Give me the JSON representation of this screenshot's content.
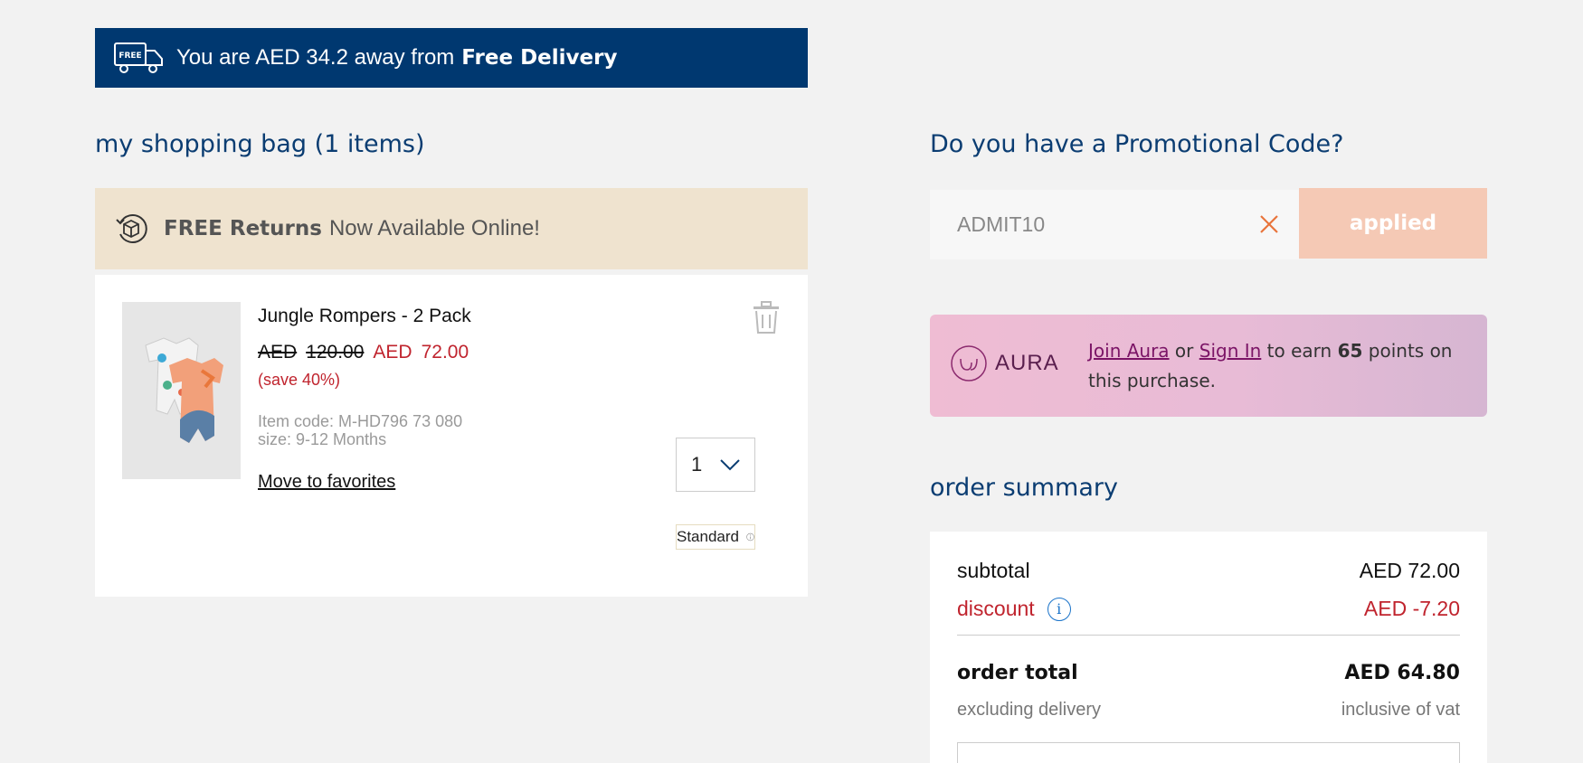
{
  "delivery_banner": {
    "icon": "free-delivery-truck-icon",
    "truck_label": "FREE",
    "message": "You are AED 34.2 away from",
    "highlight": "Free Delivery"
  },
  "bag": {
    "title": "my shopping bag (1 items)"
  },
  "returns_banner": {
    "icon": "returns-box-icon",
    "highlight": "FREE Returns",
    "message": "Now Available Online!"
  },
  "product": {
    "name": "Jungle Rompers - 2 Pack",
    "old_currency": "AED",
    "old_price": "120.00",
    "new_currency": "AED",
    "new_price": "72.00",
    "save": "(save 40%)",
    "item_code": "Item code: M-HD796 73 080",
    "size": "size: 9-12 Months",
    "favorites_link": "Move to favorites",
    "quantity": "1",
    "delivery_type": "Standard"
  },
  "promo": {
    "title": "Do you have a Promotional Code?",
    "code_value": "ADMIT10",
    "button_label": "applied"
  },
  "aura": {
    "logo_text": "AURA",
    "join_link": "Join Aura",
    "or_text": "or",
    "signin_link": "Sign In",
    "earn_text": "to earn",
    "points": "65",
    "points_suffix": "points on this purchase."
  },
  "summary": {
    "title": "order summary",
    "subtotal_label": "subtotal",
    "subtotal_value": "AED 72.00",
    "discount_label": "discount",
    "discount_value": "AED -7.20",
    "total_label": "order total",
    "total_value": "AED 64.80",
    "note_left": "excluding delivery",
    "note_right": "inclusive of vat"
  },
  "colors": {
    "brand_navy": "#003870",
    "title_blue": "#0b3d72",
    "sale_red": "#c0242e",
    "returns_beige": "#efe3cf",
    "applied_peach": "#f5c9b5",
    "aura_pink": "#efbcd3",
    "clear_orange": "#e8743b",
    "info_blue": "#1a73c9"
  }
}
